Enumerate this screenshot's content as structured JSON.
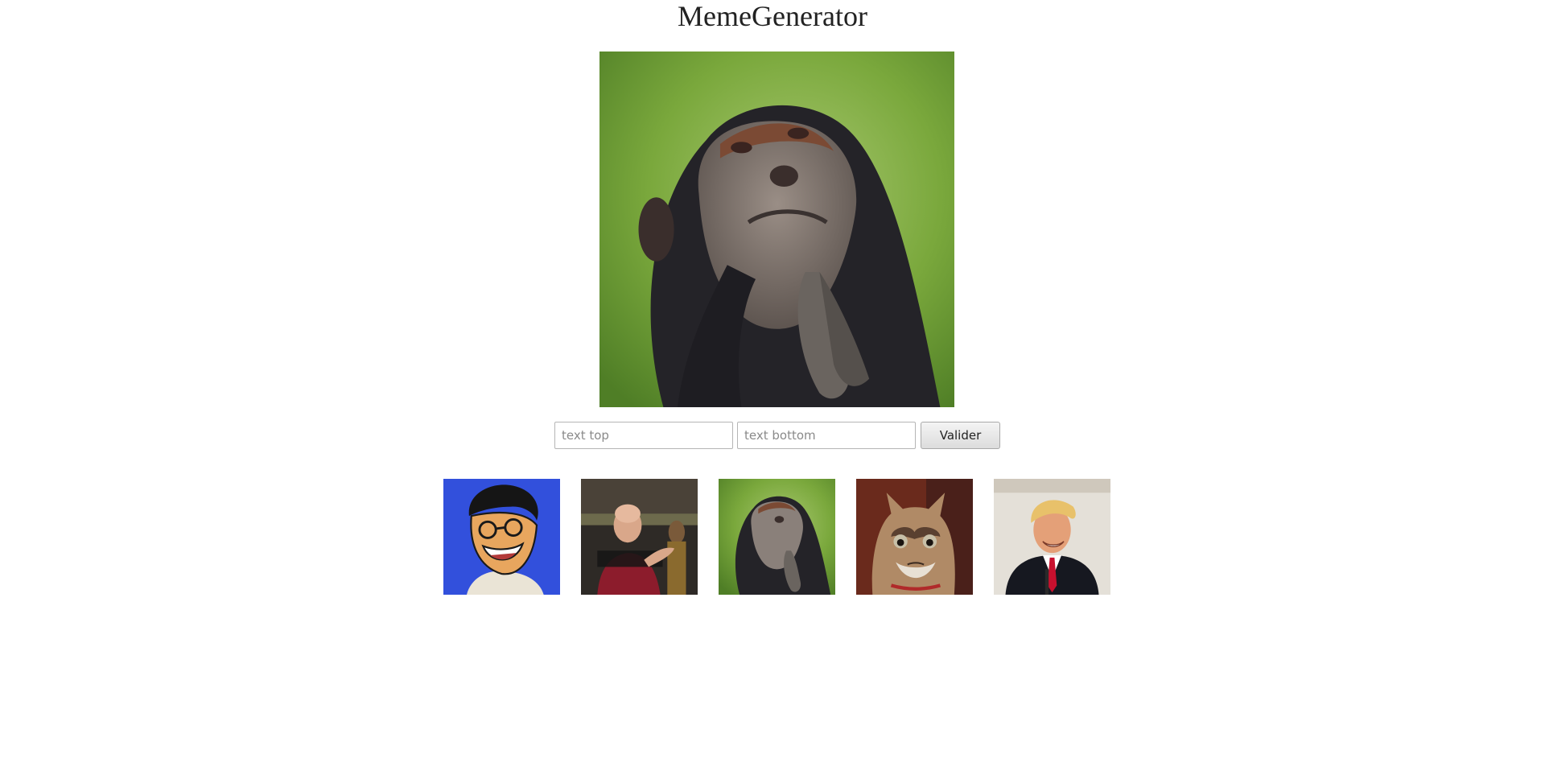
{
  "app": {
    "title": "MemeGenerator"
  },
  "preview": {
    "meme": "chimpanzee-praying",
    "top_text": "",
    "bottom_text": ""
  },
  "form": {
    "top_placeholder": "text top",
    "bottom_placeholder": "text bottom",
    "top_value": "",
    "bottom_value": "",
    "submit_label": "Valider"
  },
  "gallery": {
    "items": [
      {
        "meme": "cartoon-laughing-man"
      },
      {
        "meme": "captain-facepalm-gesture"
      },
      {
        "meme": "chimpanzee-praying",
        "selected": true
      },
      {
        "meme": "grumpy-cat"
      },
      {
        "meme": "smiling-politician"
      }
    ]
  },
  "colors": {
    "chimp_bg": "#7aa83c",
    "cartoon_bg": "#3250dc",
    "cat_bg": "#6a2a1c",
    "politician_bg": "#e4e0d8"
  }
}
